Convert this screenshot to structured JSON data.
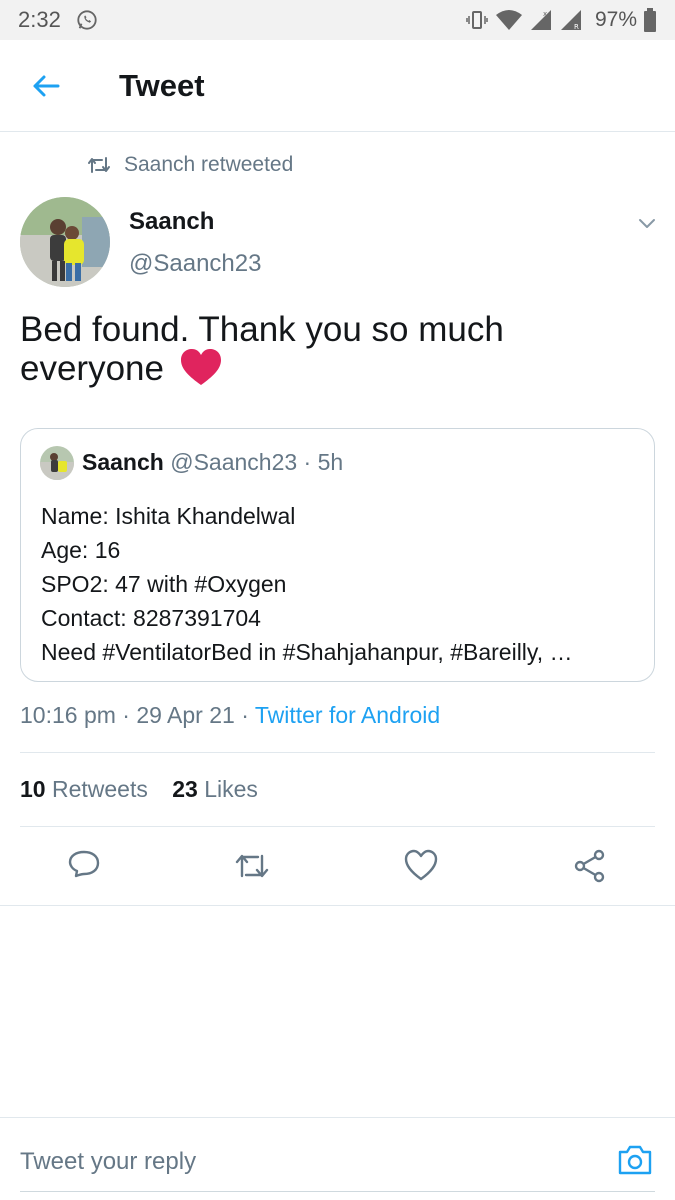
{
  "status_bar": {
    "time": "2:32",
    "battery": "97%"
  },
  "header": {
    "title": "Tweet"
  },
  "retweet": {
    "label": "Saanch retweeted"
  },
  "tweet": {
    "author_name": "Saanch",
    "author_handle": "@Saanch23",
    "text": "Bed found. Thank you so much everyone",
    "emoji": "red-heart",
    "timestamp": "10:16 pm · 29 Apr 21 · ",
    "source": "Twitter for Android"
  },
  "quote": {
    "author_name": "Saanch",
    "meta": "@Saanch23 · 5h",
    "lines": [
      "Name: Ishita Khandelwal",
      "Age: 16",
      "SPO2: 47 with #Oxygen",
      "Contact: 8287391704",
      "Need #VentilatorBed in #Shahjahanpur, #Bareilly, …"
    ]
  },
  "stats": {
    "retweets_count": "10",
    "retweets_label": "Retweets",
    "likes_count": "23",
    "likes_label": "Likes"
  },
  "actions": [
    "reply-icon",
    "retweet-icon",
    "like-icon",
    "share-icon"
  ],
  "reply": {
    "placeholder": "Tweet your reply"
  },
  "colors": {
    "accent": "#1da1f2",
    "text": "#14171a",
    "secondary": "#657786",
    "divider": "#e1e8ed",
    "heart": "#e0245e"
  }
}
